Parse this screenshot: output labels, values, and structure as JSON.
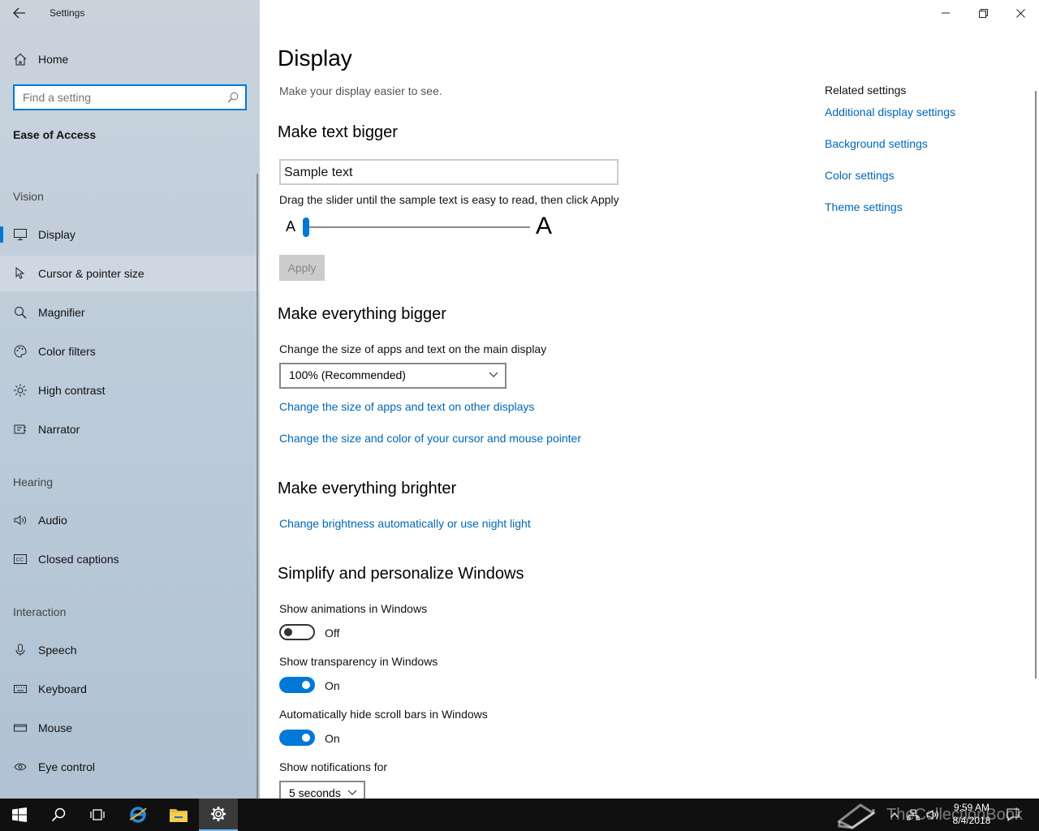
{
  "window": {
    "app_title": "Settings"
  },
  "sidebar": {
    "home_label": "Home",
    "search_placeholder": "Find a setting",
    "section_title": "Ease of Access",
    "groups": {
      "vision": "Vision",
      "hearing": "Hearing",
      "interaction": "Interaction"
    },
    "items": {
      "display": "Display",
      "cursor": "Cursor & pointer size",
      "magnifier": "Magnifier",
      "color_filters": "Color filters",
      "high_contrast": "High contrast",
      "narrator": "Narrator",
      "audio": "Audio",
      "closed_captions": "Closed captions",
      "speech": "Speech",
      "keyboard": "Keyboard",
      "mouse": "Mouse",
      "eye_control": "Eye control"
    }
  },
  "main": {
    "title": "Display",
    "subtitle": "Make your display easier to see.",
    "text_bigger": {
      "heading": "Make text bigger",
      "sample_text": "Sample text",
      "instructions": "Drag the slider until the sample text is easy to read, then click Apply",
      "small_a": "A",
      "big_a": "A",
      "slider_value": 0,
      "apply_label": "Apply"
    },
    "everything_bigger": {
      "heading": "Make everything bigger",
      "label": "Change the size of apps and text on the main display",
      "selected": "100% (Recommended)",
      "link1": "Change the size of apps and text on other displays",
      "link2": "Change the size and color of your cursor and mouse pointer"
    },
    "brighter": {
      "heading": "Make everything brighter",
      "link": "Change brightness automatically or use night light"
    },
    "simplify": {
      "heading": "Simplify and personalize Windows",
      "animations_label": "Show animations in Windows",
      "animations_state": "Off",
      "transparency_label": "Show transparency in Windows",
      "transparency_state": "On",
      "scrollbars_label": "Automatically hide scroll bars in Windows",
      "scrollbars_state": "On",
      "notifications_label": "Show notifications for",
      "notifications_value": "5 seconds"
    },
    "related": {
      "title": "Related settings",
      "links": [
        "Additional display settings",
        "Background settings",
        "Color settings",
        "Theme settings"
      ]
    }
  },
  "taskbar": {
    "time": "9:59 AM",
    "date": "8/4/2018",
    "watermark": "TheCollectionBook"
  },
  "colors": {
    "accent": "#0078d7",
    "link": "#0067b8",
    "taskbar": "#101010"
  }
}
